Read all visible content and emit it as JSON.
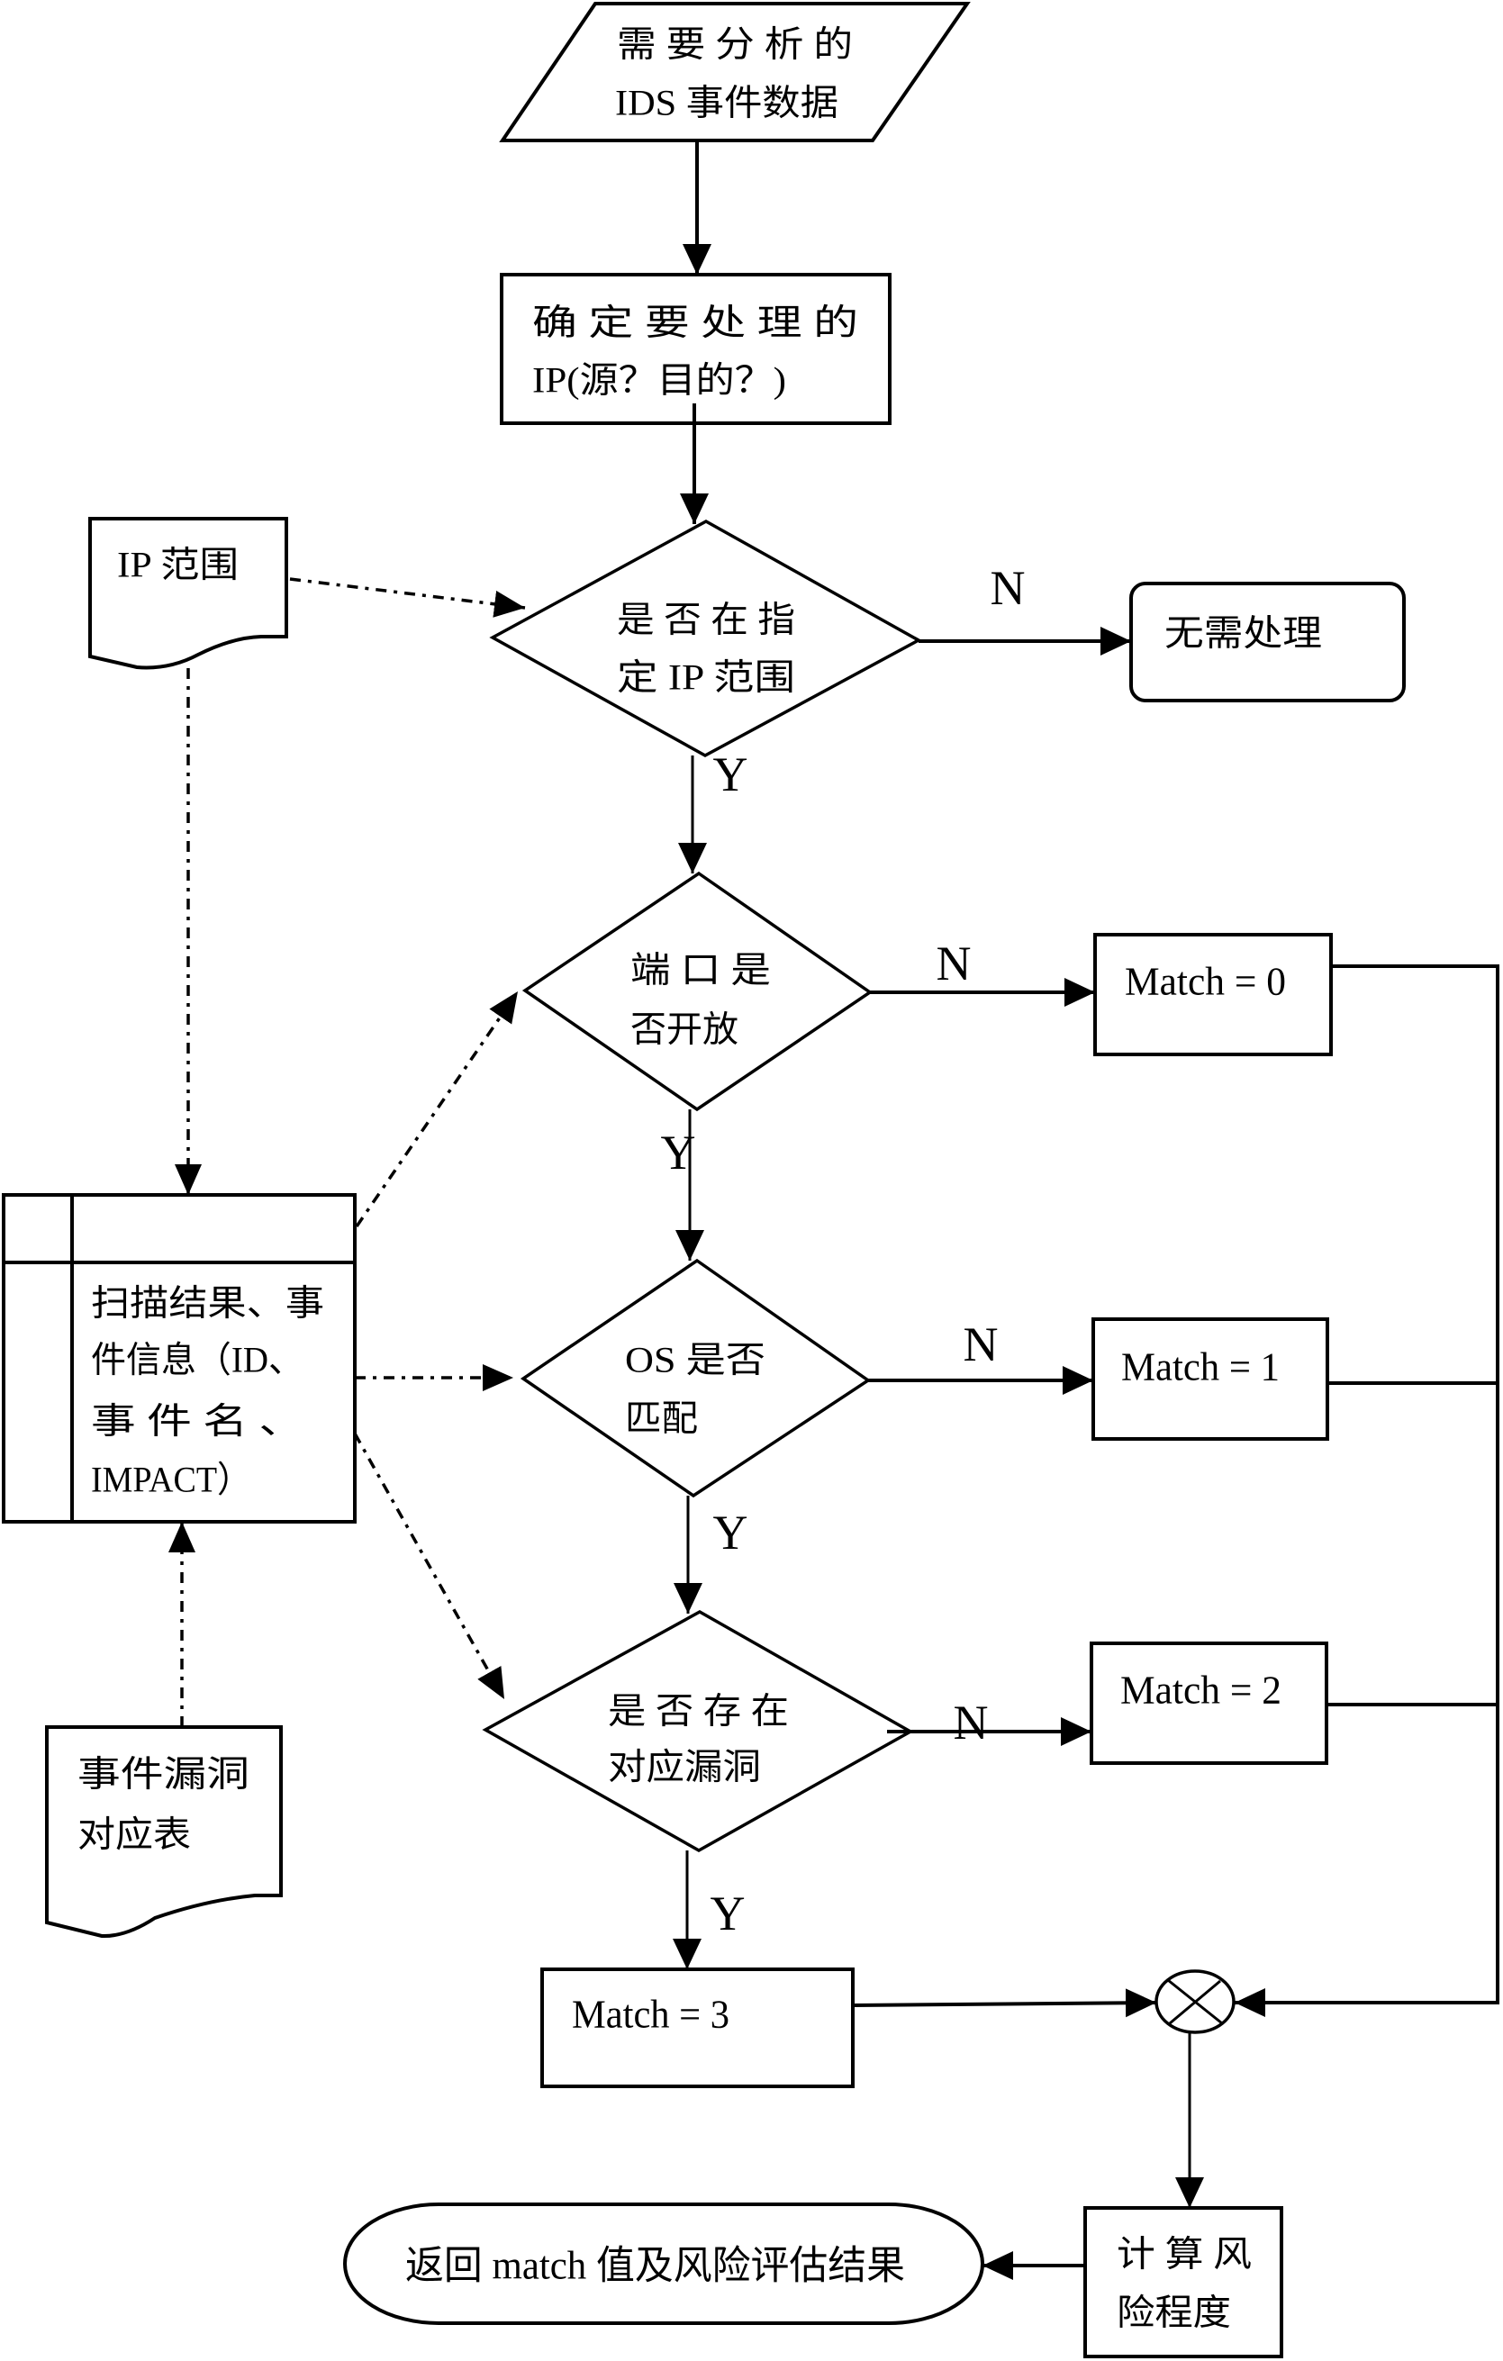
{
  "colors": {
    "stroke": "#000000",
    "background": "#ffffff"
  },
  "nodes": {
    "input_data": {
      "shape": "parallelogram",
      "role": "input",
      "lines": [
        "需 要 分 析 的",
        "IDS 事件数据"
      ]
    },
    "determine_ip": {
      "shape": "rectangle",
      "role": "process",
      "lines": [
        "确 定 要 处 理 的",
        "IP(源？目的？)"
      ]
    },
    "ip_range_doc": {
      "shape": "document",
      "role": "reference-data",
      "lines": [
        "IP 范围"
      ]
    },
    "decision_ip_range": {
      "shape": "diamond",
      "role": "decision",
      "lines": [
        "是 否 在 指",
        "定 IP 范围"
      ]
    },
    "no_processing": {
      "shape": "rounded-rectangle",
      "role": "terminal",
      "lines": [
        "无需处理"
      ]
    },
    "decision_port_open": {
      "shape": "diamond",
      "role": "decision",
      "lines": [
        "端 口 是",
        "否开放"
      ]
    },
    "match_0": {
      "shape": "rectangle",
      "role": "process",
      "lines": [
        "Match = 0"
      ]
    },
    "decision_os_match": {
      "shape": "diamond",
      "role": "decision",
      "lines": [
        "OS 是否",
        "匹配"
      ]
    },
    "match_1": {
      "shape": "rectangle",
      "role": "process",
      "lines": [
        "Match = 1"
      ]
    },
    "decision_vulnerability": {
      "shape": "diamond",
      "role": "decision",
      "lines": [
        "是 否 存 在",
        "对应漏洞"
      ]
    },
    "match_2": {
      "shape": "rectangle",
      "role": "process",
      "lines": [
        "Match = 2"
      ]
    },
    "match_3": {
      "shape": "rectangle",
      "role": "process",
      "lines": [
        "Match = 3"
      ]
    },
    "scan_results_store": {
      "shape": "internal-storage",
      "role": "reference-data",
      "lines": [
        "扫描结果、事",
        "件信息（ID、",
        "事 件 名 、",
        "IMPACT）"
      ]
    },
    "event_vuln_table": {
      "shape": "document",
      "role": "reference-data",
      "lines": [
        "事件漏洞",
        "对应表"
      ]
    },
    "summing_junction": {
      "shape": "summing-junction",
      "role": "merge",
      "lines": []
    },
    "compute_risk": {
      "shape": "rectangle",
      "role": "process",
      "lines": [
        "计 算 风",
        "险程度"
      ]
    },
    "return_result": {
      "shape": "terminator",
      "role": "end",
      "lines": [
        "返回 match 值及风险评估结果"
      ]
    }
  },
  "edges": [
    {
      "from": "input_data",
      "to": "determine_ip",
      "kind": "control",
      "label": ""
    },
    {
      "from": "determine_ip",
      "to": "decision_ip_range",
      "kind": "control",
      "label": ""
    },
    {
      "from": "ip_range_doc",
      "to": "decision_ip_range",
      "kind": "data-reference",
      "label": ""
    },
    {
      "from": "decision_ip_range",
      "to": "no_processing",
      "kind": "control",
      "label": "N"
    },
    {
      "from": "decision_ip_range",
      "to": "decision_port_open",
      "kind": "control",
      "label": "Y"
    },
    {
      "from": "ip_range_doc",
      "to": "scan_results_store",
      "kind": "data-reference",
      "label": ""
    },
    {
      "from": "scan_results_store",
      "to": "decision_port_open",
      "kind": "data-reference",
      "label": ""
    },
    {
      "from": "scan_results_store",
      "to": "decision_os_match",
      "kind": "data-reference",
      "label": ""
    },
    {
      "from": "scan_results_store",
      "to": "decision_vulnerability",
      "kind": "data-reference",
      "label": ""
    },
    {
      "from": "event_vuln_table",
      "to": "scan_results_store",
      "kind": "data-reference",
      "label": ""
    },
    {
      "from": "decision_port_open",
      "to": "match_0",
      "kind": "control",
      "label": "N"
    },
    {
      "from": "decision_port_open",
      "to": "decision_os_match",
      "kind": "control",
      "label": "Y"
    },
    {
      "from": "decision_os_match",
      "to": "match_1",
      "kind": "control",
      "label": "N"
    },
    {
      "from": "decision_os_match",
      "to": "decision_vulnerability",
      "kind": "control",
      "label": "Y"
    },
    {
      "from": "decision_vulnerability",
      "to": "match_2",
      "kind": "control",
      "label": "N"
    },
    {
      "from": "decision_vulnerability",
      "to": "match_3",
      "kind": "control",
      "label": "Y"
    },
    {
      "from": "match_0",
      "to": "summing_junction",
      "kind": "control",
      "label": ""
    },
    {
      "from": "match_1",
      "to": "summing_junction",
      "kind": "control",
      "label": ""
    },
    {
      "from": "match_2",
      "to": "summing_junction",
      "kind": "control",
      "label": ""
    },
    {
      "from": "match_3",
      "to": "summing_junction",
      "kind": "control",
      "label": ""
    },
    {
      "from": "summing_junction",
      "to": "compute_risk",
      "kind": "control",
      "label": ""
    },
    {
      "from": "compute_risk",
      "to": "return_result",
      "kind": "control",
      "label": ""
    }
  ]
}
